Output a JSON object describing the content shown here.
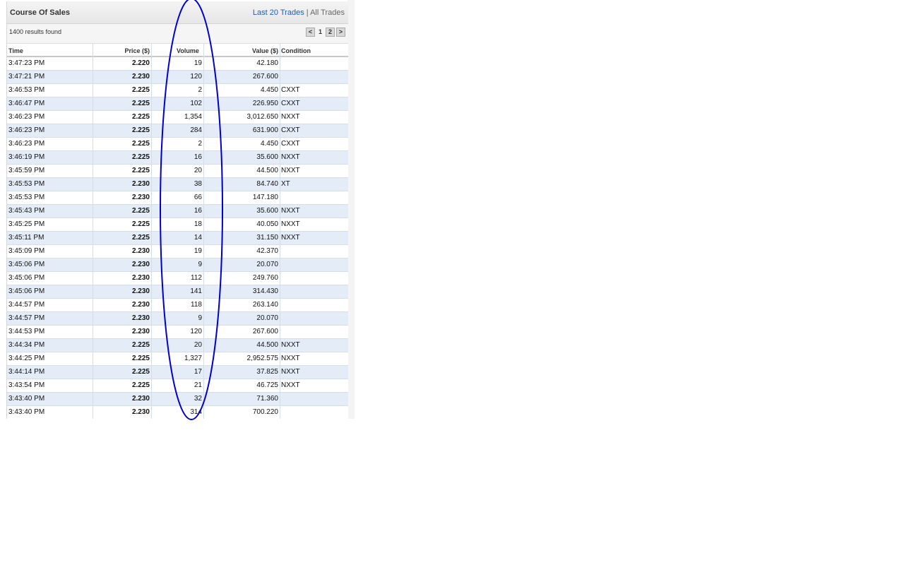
{
  "panel": {
    "title": "Course Of Sales",
    "links": {
      "last20": "Last 20 Trades",
      "separator": "|",
      "all": "All Trades"
    },
    "results_count": "1400 results found",
    "pager": {
      "prev": "<",
      "current_page": "1",
      "next_page": "2",
      "next": ">"
    }
  },
  "table": {
    "headers": {
      "time": "Time",
      "price": "Price ($)",
      "volume": "Volume",
      "value": "Value ($)",
      "condition": "Condition"
    },
    "rows": [
      {
        "time": "3:47:23 PM",
        "price": "2.220",
        "volume": "19",
        "value": "42.180",
        "condition": ""
      },
      {
        "time": "3:47:21 PM",
        "price": "2.230",
        "volume": "120",
        "value": "267.600",
        "condition": ""
      },
      {
        "time": "3:46:53 PM",
        "price": "2.225",
        "volume": "2",
        "value": "4.450",
        "condition": "CXXT"
      },
      {
        "time": "3:46:47 PM",
        "price": "2.225",
        "volume": "102",
        "value": "226.950",
        "condition": "CXXT"
      },
      {
        "time": "3:46:23 PM",
        "price": "2.225",
        "volume": "1,354",
        "value": "3,012.650",
        "condition": "NXXT"
      },
      {
        "time": "3:46:23 PM",
        "price": "2.225",
        "volume": "284",
        "value": "631.900",
        "condition": "CXXT"
      },
      {
        "time": "3:46:23 PM",
        "price": "2.225",
        "volume": "2",
        "value": "4.450",
        "condition": "CXXT"
      },
      {
        "time": "3:46:19 PM",
        "price": "2.225",
        "volume": "16",
        "value": "35.600",
        "condition": "NXXT"
      },
      {
        "time": "3:45:59 PM",
        "price": "2.225",
        "volume": "20",
        "value": "44.500",
        "condition": "NXXT"
      },
      {
        "time": "3:45:53 PM",
        "price": "2.230",
        "volume": "38",
        "value": "84.740",
        "condition": "XT"
      },
      {
        "time": "3:45:53 PM",
        "price": "2.230",
        "volume": "66",
        "value": "147.180",
        "condition": ""
      },
      {
        "time": "3:45:43 PM",
        "price": "2.225",
        "volume": "16",
        "value": "35.600",
        "condition": "NXXT"
      },
      {
        "time": "3:45:25 PM",
        "price": "2.225",
        "volume": "18",
        "value": "40.050",
        "condition": "NXXT"
      },
      {
        "time": "3:45:11 PM",
        "price": "2.225",
        "volume": "14",
        "value": "31.150",
        "condition": "NXXT"
      },
      {
        "time": "3:45:09 PM",
        "price": "2.230",
        "volume": "19",
        "value": "42.370",
        "condition": ""
      },
      {
        "time": "3:45:06 PM",
        "price": "2.230",
        "volume": "9",
        "value": "20.070",
        "condition": ""
      },
      {
        "time": "3:45:06 PM",
        "price": "2.230",
        "volume": "112",
        "value": "249.760",
        "condition": ""
      },
      {
        "time": "3:45:06 PM",
        "price": "2.230",
        "volume": "141",
        "value": "314.430",
        "condition": ""
      },
      {
        "time": "3:44:57 PM",
        "price": "2.230",
        "volume": "118",
        "value": "263.140",
        "condition": ""
      },
      {
        "time": "3:44:57 PM",
        "price": "2.230",
        "volume": "9",
        "value": "20.070",
        "condition": ""
      },
      {
        "time": "3:44:53 PM",
        "price": "2.230",
        "volume": "120",
        "value": "267.600",
        "condition": ""
      },
      {
        "time": "3:44:34 PM",
        "price": "2.225",
        "volume": "20",
        "value": "44.500",
        "condition": "NXXT"
      },
      {
        "time": "3:44:25 PM",
        "price": "2.225",
        "volume": "1,327",
        "value": "2,952.575",
        "condition": "NXXT"
      },
      {
        "time": "3:44:14 PM",
        "price": "2.225",
        "volume": "17",
        "value": "37.825",
        "condition": "NXXT"
      },
      {
        "time": "3:43:54 PM",
        "price": "2.225",
        "volume": "21",
        "value": "46.725",
        "condition": "NXXT"
      },
      {
        "time": "3:43:40 PM",
        "price": "2.230",
        "volume": "32",
        "value": "71.360",
        "condition": ""
      },
      {
        "time": "3:43:40 PM",
        "price": "2.230",
        "volume": "314",
        "value": "700.220",
        "condition": ""
      }
    ]
  },
  "colors": {
    "link": "#1d5fa8",
    "row_alt": "#e4edf7",
    "annotation_ellipse": "#0000cc"
  }
}
